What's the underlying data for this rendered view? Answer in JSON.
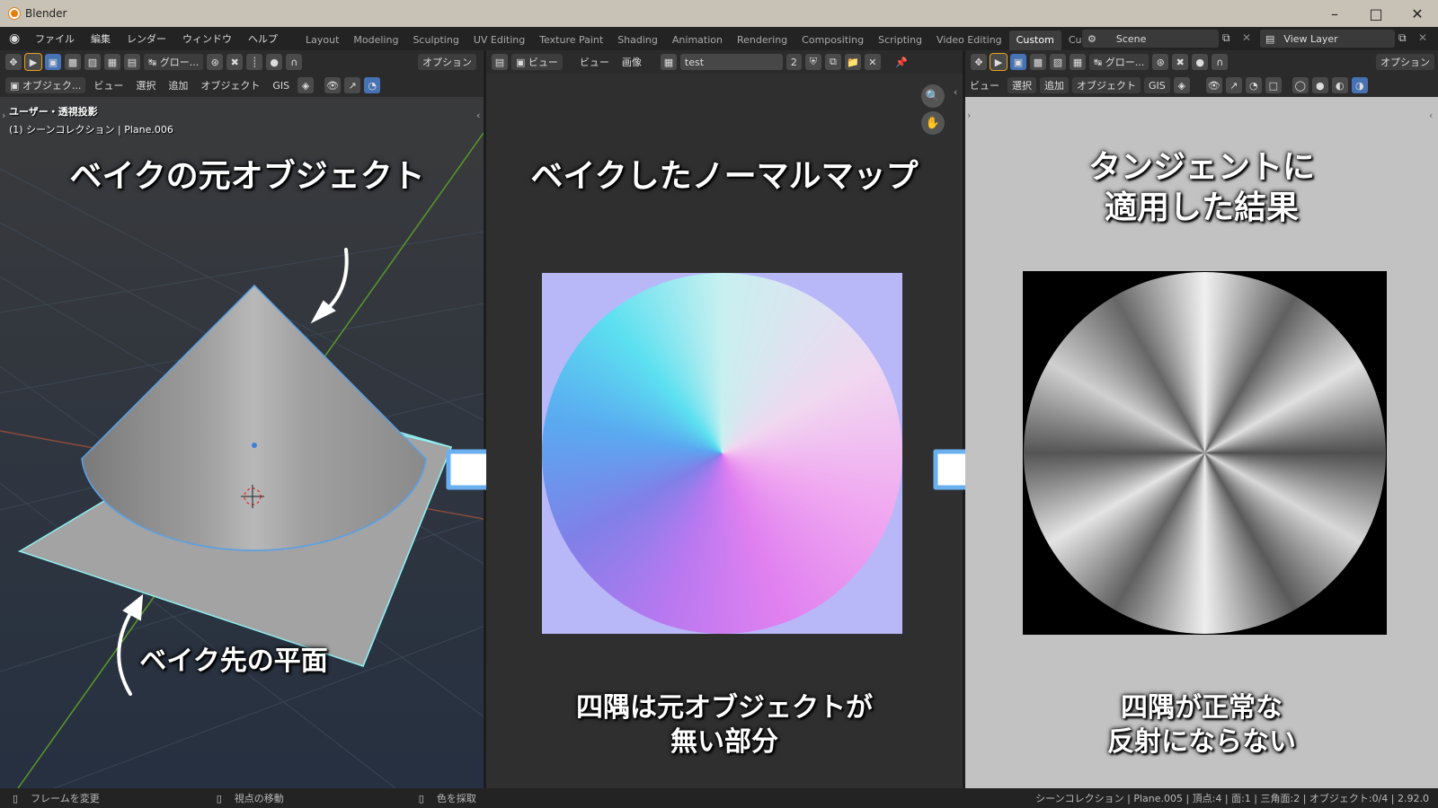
{
  "window": {
    "title": "Blender"
  },
  "menu": [
    "ファイル",
    "編集",
    "レンダー",
    "ウィンドウ",
    "ヘルプ"
  ],
  "workspaces": [
    "Layout",
    "Modeling",
    "Sculpting",
    "UV Editing",
    "Texture Paint",
    "Shading",
    "Animation",
    "Rendering",
    "Compositing",
    "Scripting",
    "Video Editing",
    "Custom",
    "Custon"
  ],
  "scene": {
    "name": "Scene",
    "view_layer": "View Layer"
  },
  "left_panel": {
    "toolbar1": {
      "transform": "グロー...",
      "options": "オプション"
    },
    "toolbar2": {
      "mode": "オブジェク...",
      "view": "ビュー",
      "select": "選択",
      "add": "追加",
      "object": "オブジェクト",
      "gis": "GIS"
    },
    "overlay_line1": "ユーザー・透視投影",
    "overlay_line2": "(1) シーンコレクション | Plane.006",
    "caption_top": "ベイクの元オブジェクト",
    "caption_bottom": "ベイク先の平面"
  },
  "mid_panel": {
    "toolbar": {
      "view1": "ビュー",
      "view2": "ビュー",
      "image": "画像",
      "image_name": "test",
      "users": "2"
    },
    "caption_top": "ベイクしたノーマルマップ",
    "caption_bottom_1": "四隅は元オブジェクトが",
    "caption_bottom_2": "無い部分"
  },
  "right_panel": {
    "toolbar1": {
      "transform": "グロー...",
      "options": "オプション"
    },
    "toolbar2": {
      "view": "ビュー",
      "select": "選択",
      "add": "追加",
      "object": "オブジェクト",
      "gis": "GIS"
    },
    "caption_top_1": "タンジェントに",
    "caption_top_2": "適用した結果",
    "caption_bottom_1": "四隅が正常な",
    "caption_bottom_2": "反射にならない"
  },
  "status": {
    "left1": "フレームを変更",
    "left2": "視点の移動",
    "left3": "色を採取",
    "right": "シーンコレクション | Plane.005 | 頂点:4 | 面:1 | 三角面:2 | オブジェクト:0/4 | 2.92.0"
  },
  "colors": {
    "accent": "#4772b3",
    "selection": "#5aa0e6",
    "arrow_outline": "#6ab0f0"
  }
}
